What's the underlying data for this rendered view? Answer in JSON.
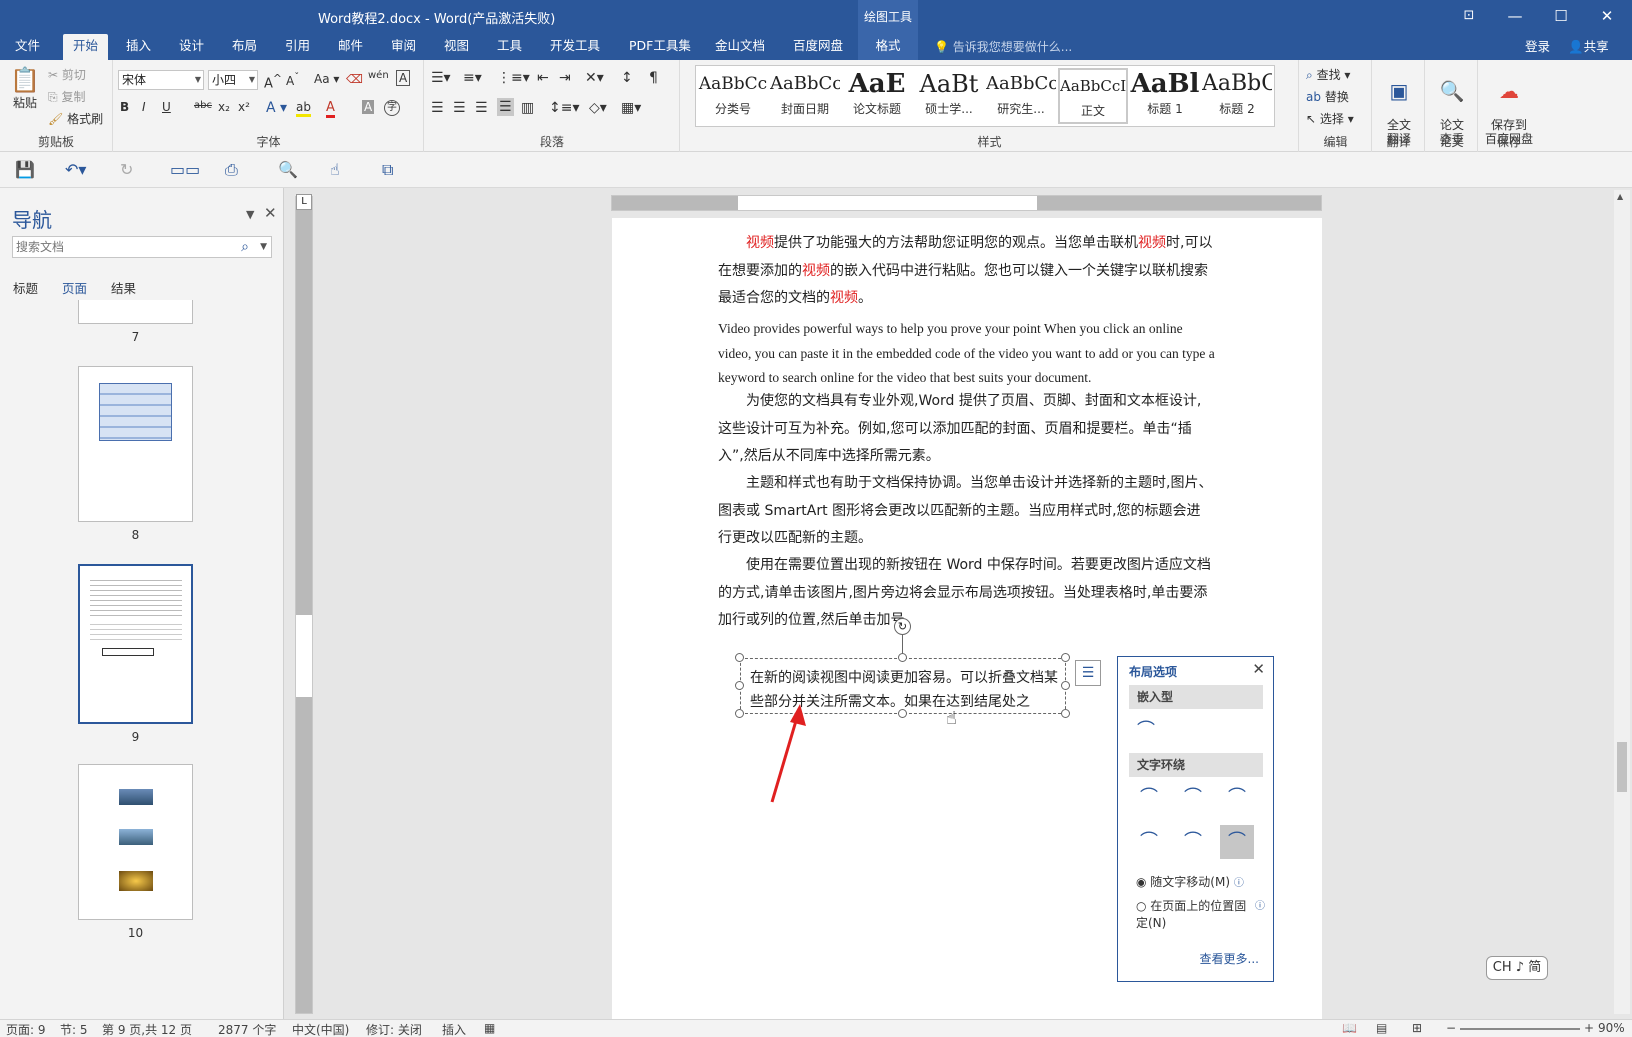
{
  "window": {
    "title": "Word教程2.docx - Word(产品激活失败)",
    "context_tab_title": "绘图工具",
    "min_glyph": "—",
    "max_glyph": "☐",
    "close_glyph": "✕",
    "ribbon_opt_glyph": "⊡"
  },
  "tabs": [
    "文件",
    "开始",
    "插入",
    "设计",
    "布局",
    "引用",
    "邮件",
    "审阅",
    "视图",
    "工具",
    "开发工具",
    "PDF工具集",
    "金山文档",
    "百度网盘",
    "格式"
  ],
  "tellme": "告诉我您想要做什么...",
  "login": "登录",
  "share": "共享",
  "ribbon": {
    "clipboard": {
      "paste": "粘贴",
      "cut": "剪切",
      "copy": "复制",
      "format_painter": "格式刷",
      "label": "剪贴板"
    },
    "font": {
      "name": "宋体",
      "size": "小四",
      "label": "字体",
      "bold": "B",
      "italic": "I",
      "underline": "U",
      "strike": "abc",
      "sub": "x₂",
      "sup": "x²"
    },
    "paragraph": {
      "label": "段落"
    },
    "styles": {
      "label": "样式",
      "items": [
        {
          "sample": "AaBbCc",
          "name": "分类号"
        },
        {
          "sample": "AaBbCc",
          "name": "封面日期"
        },
        {
          "sample": "AaE",
          "name": "论文标题"
        },
        {
          "sample": "AaBt",
          "name": "硕士学..."
        },
        {
          "sample": "AaBbCc",
          "name": "研究生..."
        },
        {
          "sample": "AaBbCcI",
          "name": "正文"
        },
        {
          "sample": "AaBl",
          "name": "标题 1"
        },
        {
          "sample": "AaBbC",
          "name": "标题 2"
        }
      ]
    },
    "editing": {
      "find": "查找",
      "replace": "替换",
      "select": "选择",
      "label": "编辑"
    },
    "translate": {
      "btn": "全文\n翻译",
      "label": "翻译"
    },
    "thesis": {
      "btn": "论文\n查重",
      "label": "论文"
    },
    "save": {
      "btn": "保存到\n百度网盘",
      "label": "保存"
    }
  },
  "nav": {
    "title": "导航",
    "search_placeholder": "搜索文档",
    "tabs": [
      "标题",
      "页面",
      "结果"
    ],
    "pages": [
      "7",
      "8",
      "9",
      "10"
    ]
  },
  "document": {
    "p1_parts": [
      "视频",
      "提供了功能强大的方法帮助您证明您的观点。当您单击联机",
      "视频",
      "时,可以在想要添加的",
      "视频",
      "的嵌入代码中进行粘贴。您也可以键入一个关键字以联机搜索最适合您的文档的",
      "视频",
      "。"
    ],
    "p2": "Video provides powerful ways to help you prove your point When you click an online video, you can paste it in the embedded code of the video you want to add or you can type a keyword to search online for the video that best suits your document.",
    "p3": "为使您的文档具有专业外观,Word 提供了页眉、页脚、封面和文本框设计,这些设计可互为补充。例如,您可以添加匹配的封面、页眉和提要栏。单击“插入”,然后从不同库中选择所需元素。",
    "p4": "主题和样式也有助于文档保持协调。当您单击设计并选择新的主题时,图片、图表或 SmartArt 图形将会更改以匹配新的主题。当应用样式时,您的标题会进行更改以匹配新的主题。",
    "p5": "使用在需要位置出现的新按钮在 Word 中保存时间。若要更改图片适应文档的方式,请单击该图片,图片旁边将会显示布局选项按钮。当处理表格时,单击要添加行或列的位置,然后单击加号。",
    "textbox": "在新的阅读视图中阅读更加容易。可以折叠文档某些部分并关注所需文本。如果在达到结尾处之"
  },
  "layout_panel": {
    "title": "布局选项",
    "inline_section": "嵌入型",
    "wrap_section": "文字环绕",
    "move_with_text": "随文字移动(M)",
    "fix_position": "在页面上的位置固定(N)",
    "see_more": "查看更多..."
  },
  "status": {
    "page": "页面: 9",
    "section": "节: 5",
    "page_of": "第 9 页,共 12 页",
    "words": "2877 个字",
    "lang": "中文(中国)",
    "track": "修订: 关闭",
    "mode": "插入",
    "zoom": "90%"
  },
  "ime": "CH ♪ 简",
  "colors": {
    "accent": "#2b579a",
    "red_text": "#e02020"
  }
}
